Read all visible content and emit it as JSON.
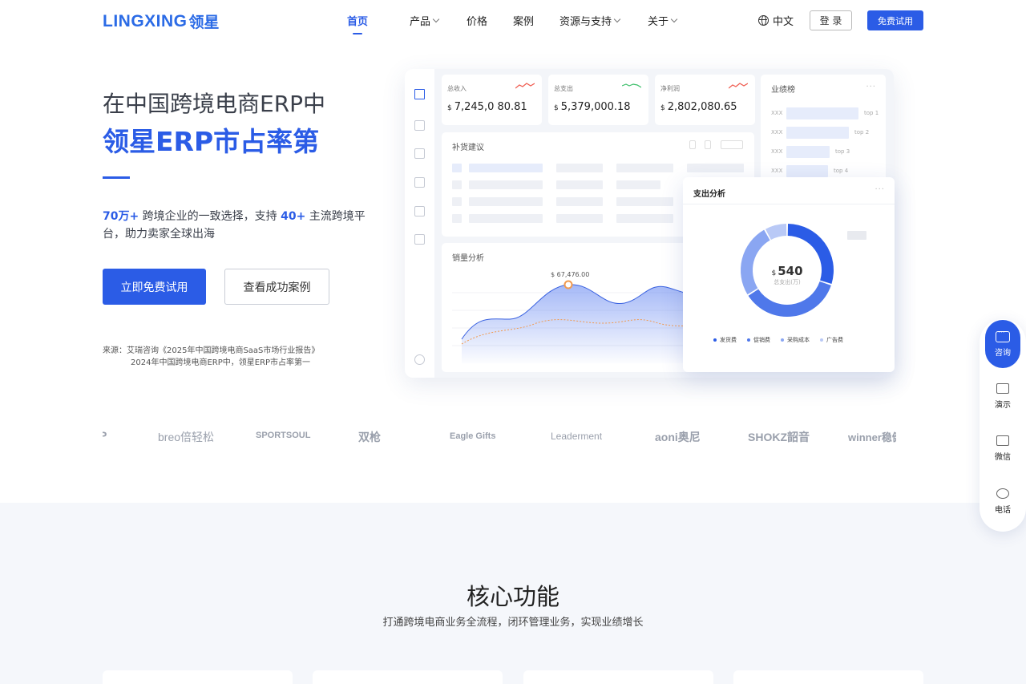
{
  "header": {
    "logo_text": "LINGXING",
    "logo_cn": "领星",
    "nav": [
      {
        "label": "首页",
        "active": true,
        "has_dropdown": false
      },
      {
        "label": "产品",
        "active": false,
        "has_dropdown": true
      },
      {
        "label": "价格",
        "active": false,
        "has_dropdown": false
      },
      {
        "label": "案例",
        "active": false,
        "has_dropdown": false
      },
      {
        "label": "资源与支持",
        "active": false,
        "has_dropdown": true
      },
      {
        "label": "关于",
        "active": false,
        "has_dropdown": true
      }
    ],
    "language": "中文",
    "login_label": "登 录",
    "trial_label": "免费试用"
  },
  "hero": {
    "line1": "在中国跨境电商ERP中",
    "line2": "领星ERP市占率第",
    "desc_hl1": "70万+",
    "desc_part1": " 跨境企业的一致选择，支持 ",
    "desc_hl2": "40+",
    "desc_part2": " 主流跨境平台，助力卖家全球出海",
    "primary_btn": "立即免费试用",
    "secondary_btn": "查看成功案例",
    "source_line1": "来源：艾瑞咨询《2025年中国跨境电商SaaS市场行业报告》",
    "source_line2": "2024年中国跨境电商ERP中，领星ERP市占率第一"
  },
  "dashboard": {
    "kpis": [
      {
        "label": "总收入",
        "currency": "$",
        "value": "7,245,0 80.81"
      },
      {
        "label": "总支出",
        "currency": "$",
        "value": "5,379,000.18"
      },
      {
        "label": "净利润",
        "currency": "$",
        "value": "2,802,080.65"
      }
    ],
    "restock_title": "补货建议",
    "ranking_title": "业绩榜",
    "ranking": [
      {
        "label": "XXX",
        "tag": "top 1"
      },
      {
        "label": "XXX",
        "tag": "top 2"
      },
      {
        "label": "XXX",
        "tag": "top 3"
      },
      {
        "label": "XXX",
        "tag": "top 4"
      }
    ],
    "sales_title": "销量分析",
    "sales_peak_label": "$ 67,476.00",
    "spend_title": "支出分析",
    "spend_value_currency": "$",
    "spend_value": "540",
    "spend_sub": "总支出(万)",
    "spend_legend": [
      "发货费",
      "促销费",
      "采购成本",
      "广告费"
    ],
    "spend_colors": [
      "#2b5ce6",
      "#4f78ea",
      "#8aa6f2",
      "#b9c9f6"
    ]
  },
  "chart_data": {
    "type": "pie",
    "title": "支出分析",
    "categories": [
      "发货费",
      "促销费",
      "采购成本",
      "广告费"
    ],
    "values": [
      30,
      36,
      26,
      8
    ]
  },
  "brands": [
    "P",
    "breo倍轻松",
    "SPORTSOUL",
    "双枪",
    "Eagle Gifts",
    "Leaderment",
    "aoni奥尼",
    "SHOKZ韶音",
    "winner稳健医疗"
  ],
  "core": {
    "title": "核心功能",
    "subtitle": "打通跨境电商业务全流程，闭环管理业务，实现业绩增长"
  },
  "float_panel": {
    "consult": "咨询",
    "demo": "演示",
    "wechat": "微信",
    "phone": "电话"
  }
}
